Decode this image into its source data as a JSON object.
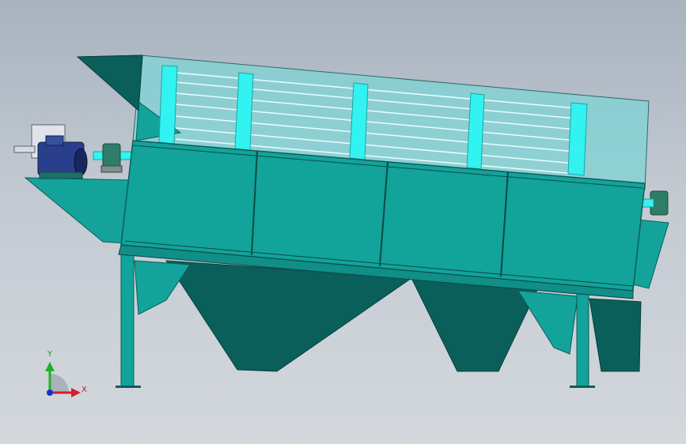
{
  "viewport": {
    "colors": {
      "background_top": "#a8b3bf",
      "background_bottom": "#d3d8dd",
      "body_teal": "#0e9e96",
      "dark_teal": "#0a5f5a",
      "screen_cyan": "#33f2f2",
      "screen_glass": "#7fd3d4",
      "motor_blue": "#2a3f8c"
    }
  },
  "triad": {
    "x_label": "X",
    "y_label": "Y",
    "x_color": "#d0202a",
    "y_color": "#22b022",
    "z_color": "#1a2fd0"
  }
}
